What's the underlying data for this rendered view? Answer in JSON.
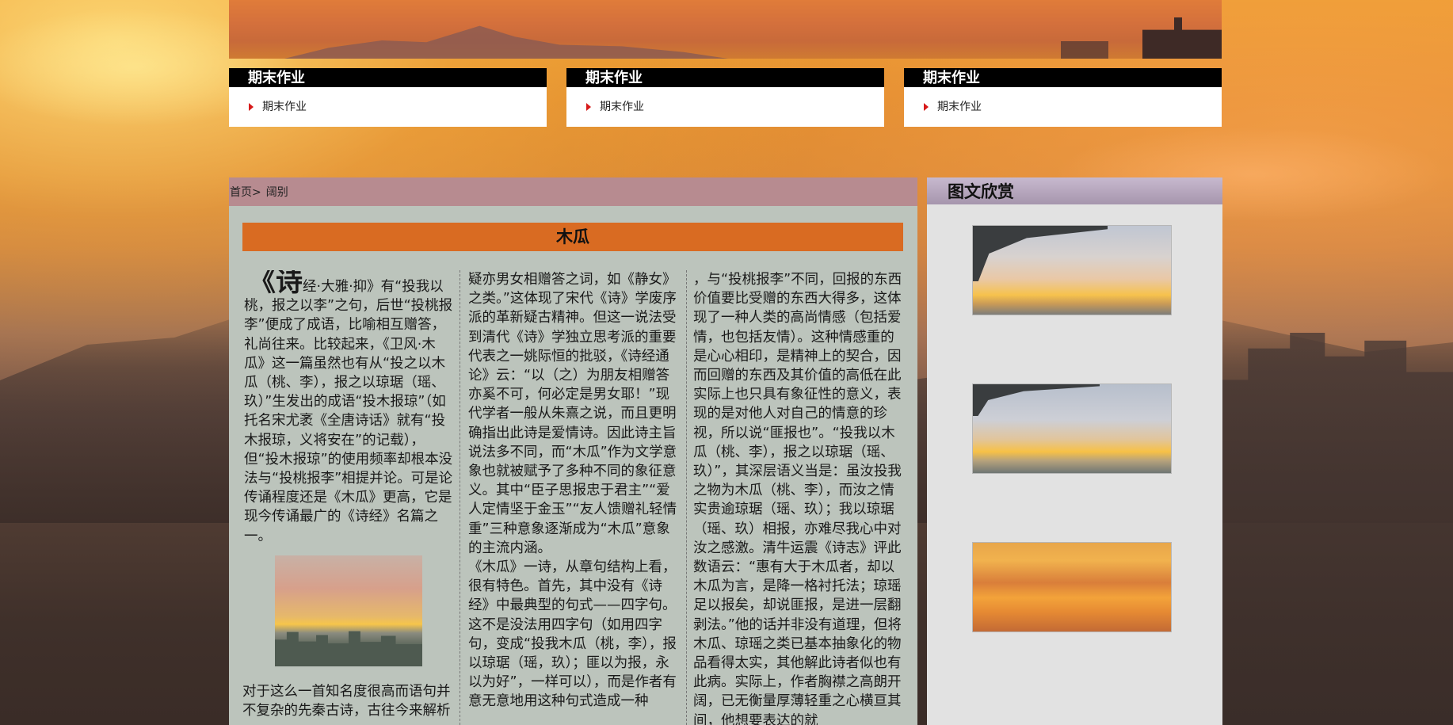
{
  "categories": [
    {
      "title": "期末作业",
      "item": "期末作业"
    },
    {
      "title": "期末作业",
      "item": "期末作业"
    },
    {
      "title": "期末作业",
      "item": "期末作业"
    }
  ],
  "breadcrumb": {
    "home": "首页>",
    "current": "阔别"
  },
  "article": {
    "title": "木瓜",
    "dropcap": "《诗",
    "col1_text": "经·大雅·抑》有“投我以桃，报之以李”之句，后世“投桃报李”便成了成语，比喻相互赠答，礼尚往来。比较起来，《卫风·木瓜》这一篇虽然也有从“投之以木瓜（桃、李），报之以琼琚（瑶、玖）”生发出的成语“投木报琼”（如托名宋尤袤《全唐诗话》就有“投木报琼，义将安在”的记载），但“投木报琼”的使用频率却根本没法与“投桃报李”相提并论。可是论传诵程度还是《木瓜》更高，它是现今传诵最广的《诗经》名篇之一。",
    "col1_after": "对于这么一首知名度很高而语句并不复杂的先秦古诗，古往今来解析",
    "col2_text": "疑亦男女相赠答之词，如《静女》之类。”这体现了宋代《诗》学废序派的革新疑古精神。但这一说法受到清代《诗》学独立思考派的重要代表之一姚际恒的批驳，《诗经通论》云：“以（之）为朋友相赠答亦奚不可，何必定是男女耶！”现代学者一般从朱熹之说，而且更明确指出此诗是爱情诗。因此诗主旨说法多不同，而“木瓜”作为文学意象也就被赋予了多种不同的象征意义。其中“臣子思报忠于君主”“爱人定情坚于金玉”“友人馈赠礼轻情重”三种意象逐渐成为“木瓜”意象的主流内涵。",
    "col2_text2": "《木瓜》一诗，从章句结构上看，很有特色。首先，其中没有《诗经》中最典型的句式——四字句。这不是没法用四字句（如用四字句，变成“投我木瓜（桃，李），报以琼琚（瑶，玖）；匪以为报，永以为好”，一样可以），而是作者有意无意地用这种句式造成一种",
    "col3_text": "，与“投桃报李”不同，回报的东西价值要比受赠的东西大得多，这体现了一种人类的高尚情感（包括爱情，也包括友情）。这种情感重的是心心相印，是精神上的契合，因而回赠的东西及其价值的高低在此实际上也只具有象征性的意义，表现的是对他人对自己的情意的珍视，所以说“匪报也”。“投我以木瓜（桃、李），报之以琼琚（瑶、玖）”，其深层语义当是：虽汝投我之物为木瓜（桃、李），而汝之情实贵逾琼琚（瑶、玖）；我以琼琚（瑶、玖）相报，亦难尽我心中对汝之感激。清牛运震《诗志》评此数语云：“惠有大于木瓜者，却以木瓜为言，是降一格衬托法；琼瑶足以报矣，却说匪报，是进一层翻剥法。”他的话并非没有道理，但将木瓜、琼瑶之类已基本抽象化的物品看得太实，其他解此诗者似也有此病。实际上，作者胸襟之高朗开阔，已无衡量厚薄轻重之心横亘其间，他想要表达的就"
  },
  "sidebar": {
    "title": "图文欣赏"
  },
  "icons": {
    "list_arrow": "red-triangle-arrow"
  },
  "colors": {
    "title_bar": "#d96b22",
    "breadcrumb_bar": "#b78b90",
    "category_header": "#000000",
    "sidebar_header": "#a695ad"
  }
}
